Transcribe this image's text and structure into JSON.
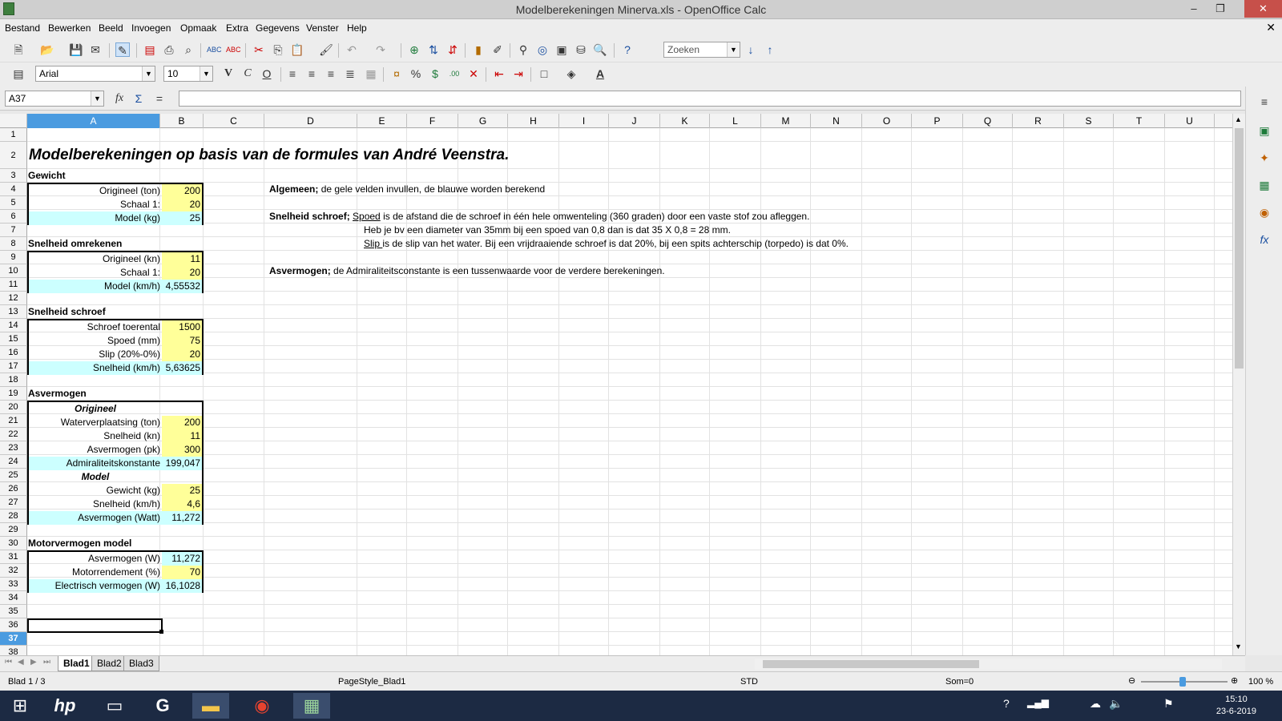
{
  "window": {
    "title": "Modelberekeningen Minerva.xls - OpenOffice Calc"
  },
  "menu": [
    "Bestand",
    "Bewerken",
    "Beeld",
    "Invoegen",
    "Opmaak",
    "Extra",
    "Gegevens",
    "Venster",
    "Help"
  ],
  "toolbar": {
    "search_placeholder": "Zoeken",
    "font_name": "Arial",
    "font_size": "10"
  },
  "formula": {
    "cell_ref": "A37",
    "content": ""
  },
  "columns": [
    "A",
    "B",
    "C",
    "D",
    "E",
    "F",
    "G",
    "H",
    "I",
    "J",
    "K",
    "L",
    "M",
    "N",
    "O",
    "P",
    "Q",
    "R",
    "S",
    "T",
    "U"
  ],
  "selected_column": "A",
  "selected_row": "37",
  "rows": [
    "1",
    "2",
    "3",
    "4",
    "5",
    "6",
    "7",
    "8",
    "9",
    "10",
    "11",
    "12",
    "13",
    "14",
    "15",
    "16",
    "17",
    "18",
    "19",
    "20",
    "21",
    "22",
    "23",
    "24",
    "25",
    "26",
    "27",
    "28",
    "29",
    "30",
    "31",
    "32",
    "33",
    "34",
    "35",
    "36",
    "37",
    "38"
  ],
  "sheet": {
    "title": "Modelberekeningen op basis van de formules van André Veenstra.",
    "gewicht": {
      "header": "Gewicht",
      "rows": [
        {
          "label": "Origineel (ton)",
          "value": "200"
        },
        {
          "label": "Schaal 1:",
          "value": "20"
        },
        {
          "label": "Model (kg)",
          "value": "25"
        }
      ]
    },
    "snelheid": {
      "header": "Snelheid omrekenen",
      "rows": [
        {
          "label": "Origineel (kn)",
          "value": "11"
        },
        {
          "label": "Schaal 1:",
          "value": "20"
        },
        {
          "label": "Model (km/h)",
          "value": "4,55532"
        }
      ]
    },
    "schroef": {
      "header": "Snelheid schroef",
      "rows": [
        {
          "label": "Schroef toerental",
          "value": "1500"
        },
        {
          "label": "Spoed (mm)",
          "value": "75"
        },
        {
          "label": "Slip (20%-0%)",
          "value": "20"
        },
        {
          "label": "Snelheid (km/h)",
          "value": "5,63625"
        }
      ]
    },
    "asvermogen": {
      "header": "Asvermogen",
      "origineel_label": "Origineel",
      "origineel": [
        {
          "label": "Waterverplaatsing (ton)",
          "value": "200"
        },
        {
          "label": "Snelheid (kn)",
          "value": "11"
        },
        {
          "label": "Asvermogen (pk)",
          "value": "300"
        },
        {
          "label": "Admiraliteitskonstante",
          "value": "199,047"
        }
      ],
      "model_label": "Model",
      "model": [
        {
          "label": "Gewicht (kg)",
          "value": "25"
        },
        {
          "label": "Snelheid (km/h)",
          "value": "4,6"
        },
        {
          "label": "Asvermogen (Watt)",
          "value": "11,272"
        }
      ]
    },
    "motor": {
      "header": "Motorvermogen model",
      "rows": [
        {
          "label": "Asvermogen (W)",
          "value": "11,272"
        },
        {
          "label": "Motorrendement (%)",
          "value": "70"
        },
        {
          "label": "Electrisch vermogen (W)",
          "value": "16,1028"
        }
      ]
    },
    "notes": {
      "algemeen_label": "Algemeen;",
      "algemeen_text": " de gele velden invullen, de blauwe worden berekend",
      "schroef_label": "Snelheid schroef;",
      "spoed_word": "Spoed",
      "spoed_text": " is de afstand die de schroef in één hele omwenteling (360 graden) door een vaste stof zou afleggen.",
      "spoed_example": "Heb je bv een diameter van 35mm bij een spoed van 0,8 dan is dat 35 X 0,8 = 28 mm.",
      "slip_word": "Slip ",
      "slip_text": "is de slip van het water. Bij een vrijdraaiende schroef is dat 20%, bij een spits achterschip (torpedo) is dat 0%.",
      "asverm_label": "Asvermogen;",
      "asverm_text": " de Admiraliteitsconstante is een tussenwaarde voor de verdere berekeningen."
    }
  },
  "tabs": [
    "Blad1",
    "Blad2",
    "Blad3"
  ],
  "status": {
    "sheet": "Blad 1 / 3",
    "pagestyle": "PageStyle_Blad1",
    "mode": "STD",
    "sum": "Som=0",
    "zoom": "100 %"
  },
  "taskbar": {
    "time": "15:10",
    "date": "23-6-2019"
  },
  "colors": {
    "input": "#ffff99",
    "computed": "#ccffff",
    "selection": "#4a9be0"
  }
}
